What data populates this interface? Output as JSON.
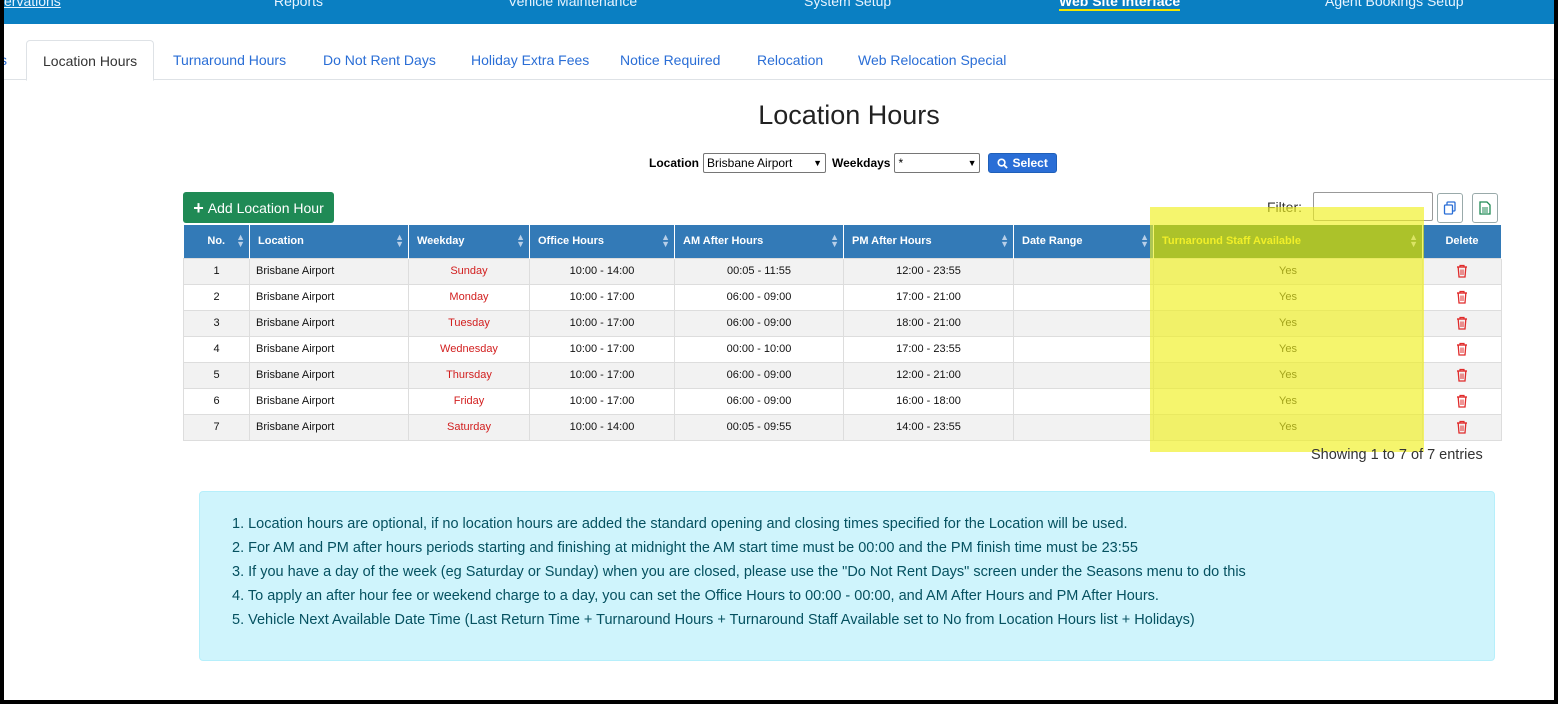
{
  "nav": {
    "items": [
      "ervations",
      "Reports",
      "Vehicle Maintenance",
      "System Setup",
      "Web Site Interface",
      "Agent Bookings Setup"
    ]
  },
  "tabs": [
    "s",
    "Location Hours",
    "Turnaround Hours",
    "Do Not Rent Days",
    "Holiday Extra Fees",
    "Notice Required",
    "Relocation",
    "Web Relocation Special"
  ],
  "page": {
    "title": "Location Hours"
  },
  "selector": {
    "location_label": "Location",
    "location_value": "Brisbane Airport",
    "weekdays_label": "Weekdays",
    "weekdays_value": "*",
    "select_label": "Select"
  },
  "toolbar": {
    "add_label": "Add Location Hour",
    "filter_label": "Filter:",
    "filter_value": ""
  },
  "table": {
    "headers": [
      "No.",
      "Location",
      "Weekday",
      "Office Hours",
      "AM After Hours",
      "PM After Hours",
      "Date Range",
      "Turnaround Staff Available",
      "Delete"
    ],
    "rows": [
      [
        "1",
        "Brisbane Airport",
        "Sunday",
        "10:00 - 14:00",
        "00:05 - 11:55",
        "12:00 - 23:55",
        "",
        "Yes"
      ],
      [
        "2",
        "Brisbane Airport",
        "Monday",
        "10:00 - 17:00",
        "06:00 - 09:00",
        "17:00 - 21:00",
        "",
        "Yes"
      ],
      [
        "3",
        "Brisbane Airport",
        "Tuesday",
        "10:00 - 17:00",
        "06:00 - 09:00",
        "18:00 - 21:00",
        "",
        "Yes"
      ],
      [
        "4",
        "Brisbane Airport",
        "Wednesday",
        "10:00 - 17:00",
        "00:00 - 10:00",
        "17:00 - 23:55",
        "",
        "Yes"
      ],
      [
        "5",
        "Brisbane Airport",
        "Thursday",
        "10:00 - 17:00",
        "06:00 - 09:00",
        "12:00 - 21:00",
        "",
        "Yes"
      ],
      [
        "6",
        "Brisbane Airport",
        "Friday",
        "10:00 - 17:00",
        "06:00 - 09:00",
        "16:00 - 18:00",
        "",
        "Yes"
      ],
      [
        "7",
        "Brisbane Airport",
        "Saturday",
        "10:00 - 14:00",
        "00:05 - 09:55",
        "14:00 - 23:55",
        "",
        "Yes"
      ]
    ],
    "entries_info": "Showing 1 to 7 of 7 entries"
  },
  "notes": [
    "1. Location hours are optional, if no location hours are added the standard opening and closing times specified for the Location will be used.",
    "2. For AM and PM after hours periods starting and finishing at midnight the AM start time must be 00:00 and the PM finish time must be 23:55",
    "3. If you have a day of the week (eg Saturday or Sunday) when you are closed, please use the \"Do Not Rent Days\" screen under the Seasons menu to do this",
    "4. To apply an after hour fee or weekend charge to a day, you can set the Office Hours to 00:00 - 00:00, and AM After Hours and PM After Hours.",
    "5. Vehicle Next Available Date Time (Last Return Time + Turnaround Hours + Turnaround Staff Available set to No from Location Hours list + Holidays)"
  ],
  "colors": {
    "nav_bg": "#0a7fc2",
    "header_bg": "#337ab7",
    "highlight": "#f0f01e",
    "weekday_text": "#d21f1f",
    "add_button": "#1f8a55",
    "notes_bg": "#cff4fc"
  },
  "icons": [
    "search-icon",
    "plus-icon",
    "copy-icon",
    "excel-icon",
    "sort-icon",
    "trash-icon"
  ]
}
